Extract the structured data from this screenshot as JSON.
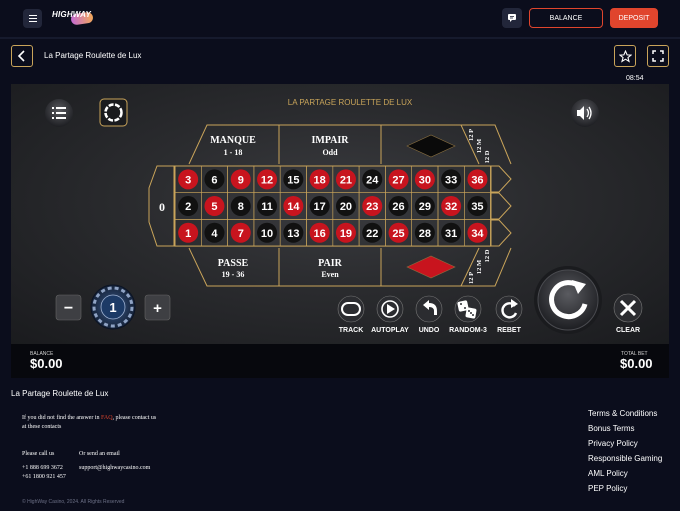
{
  "header": {
    "logo_text": "HIGHWAY",
    "balance_label": "BALANCE",
    "deposit_label": "DEPOSIT"
  },
  "game_bar": {
    "title": "La Partage Roulette de Lux",
    "time": "08:54"
  },
  "game": {
    "table_title": "LA PARTAGE ROULETTE DE LUX",
    "zero": "0",
    "number_rows": [
      [
        {
          "n": "3",
          "c": "red"
        },
        {
          "n": "6",
          "c": "black"
        },
        {
          "n": "9",
          "c": "red"
        },
        {
          "n": "12",
          "c": "red"
        },
        {
          "n": "15",
          "c": "black"
        },
        {
          "n": "18",
          "c": "red"
        },
        {
          "n": "21",
          "c": "red"
        },
        {
          "n": "24",
          "c": "black"
        },
        {
          "n": "27",
          "c": "red"
        },
        {
          "n": "30",
          "c": "red"
        },
        {
          "n": "33",
          "c": "black"
        },
        {
          "n": "36",
          "c": "red"
        }
      ],
      [
        {
          "n": "2",
          "c": "black"
        },
        {
          "n": "5",
          "c": "red"
        },
        {
          "n": "8",
          "c": "black"
        },
        {
          "n": "11",
          "c": "black"
        },
        {
          "n": "14",
          "c": "red"
        },
        {
          "n": "17",
          "c": "black"
        },
        {
          "n": "20",
          "c": "black"
        },
        {
          "n": "23",
          "c": "red"
        },
        {
          "n": "26",
          "c": "black"
        },
        {
          "n": "29",
          "c": "black"
        },
        {
          "n": "32",
          "c": "red"
        },
        {
          "n": "35",
          "c": "black"
        }
      ],
      [
        {
          "n": "1",
          "c": "red"
        },
        {
          "n": "4",
          "c": "black"
        },
        {
          "n": "7",
          "c": "red"
        },
        {
          "n": "10",
          "c": "black"
        },
        {
          "n": "13",
          "c": "black"
        },
        {
          "n": "16",
          "c": "red"
        },
        {
          "n": "19",
          "c": "red"
        },
        {
          "n": "22",
          "c": "black"
        },
        {
          "n": "25",
          "c": "red"
        },
        {
          "n": "28",
          "c": "black"
        },
        {
          "n": "31",
          "c": "black"
        },
        {
          "n": "34",
          "c": "red"
        }
      ]
    ],
    "top_bets": [
      {
        "title": "MANQUE",
        "sub": "1 - 18"
      },
      {
        "title": "IMPAIR",
        "sub": "Odd"
      }
    ],
    "bottom_bets": [
      {
        "title": "PASSE",
        "sub": "19 - 36"
      },
      {
        "title": "PAIR",
        "sub": "Even"
      }
    ],
    "dozen_labels": [
      "12 P",
      "12 M",
      "12 D"
    ],
    "chip_value": "1",
    "chip_minus": "−",
    "chip_plus": "+",
    "actions": [
      "TRACK",
      "AUTOPLAY",
      "UNDO",
      "RANDOM-3",
      "REBET"
    ],
    "clear_label": "CLEAR",
    "balance_label": "BALANCE",
    "balance_value": "$0.00",
    "total_bet_label": "TOTAL BET",
    "total_bet_value": "$0.00",
    "colors": {
      "red": "#c8141e",
      "black": "#111111",
      "gold": "#c9a45a",
      "felt": "#2b2c30"
    }
  },
  "footer": {
    "title": "La Partage Roulette de Lux",
    "help_prefix": "If you did not find the answer in ",
    "help_link": "FAQ",
    "help_suffix": ", please contact us at these contacts",
    "call_label": "Please call us",
    "phone1": "+1 888 699 3672",
    "phone2": "+61 1800 921 457",
    "email_label": "Or send an email",
    "email": "support@highwaycasino.com",
    "copyright": "© HighWay Casino, 2024. All Rights Reserved",
    "links": [
      "Terms & Conditions",
      "Bonus Terms",
      "Privacy Policy",
      "Responsible Gaming",
      "AML Policy",
      "PEP Policy"
    ]
  }
}
